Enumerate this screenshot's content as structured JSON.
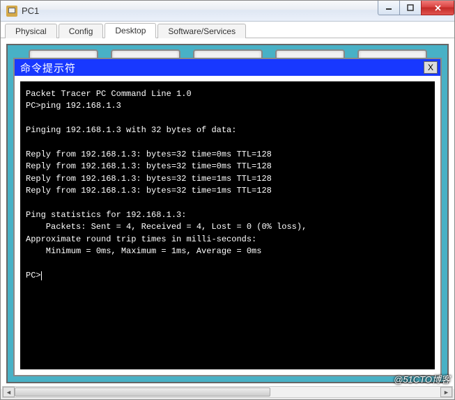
{
  "os": {
    "title": "PC1"
  },
  "tabs": [
    {
      "label": "Physical",
      "active": false
    },
    {
      "label": "Config",
      "active": false
    },
    {
      "label": "Desktop",
      "active": true
    },
    {
      "label": "Software/Services",
      "active": false
    }
  ],
  "cmd": {
    "title": "命令提示符",
    "close_label": "X",
    "header_line": "Packet Tracer PC Command Line 1.0",
    "prompt_cmd": "PC>ping 192.168.1.3",
    "pinging_line": "Pinging 192.168.1.3 with 32 bytes of data:",
    "replies": [
      "Reply from 192.168.1.3: bytes=32 time=0ms TTL=128",
      "Reply from 192.168.1.3: bytes=32 time=0ms TTL=128",
      "Reply from 192.168.1.3: bytes=32 time=1ms TTL=128",
      "Reply from 192.168.1.3: bytes=32 time=1ms TTL=128"
    ],
    "stats_header": "Ping statistics for 192.168.1.3:",
    "stats_packets": "    Packets: Sent = 4, Received = 4, Lost = 0 (0% loss),",
    "rtt_header": "Approximate round trip times in milli-seconds:",
    "rtt_values": "    Minimum = 0ms, Maximum = 1ms, Average = 0ms",
    "final_prompt": "PC>"
  },
  "watermark": "@51CTO博客"
}
